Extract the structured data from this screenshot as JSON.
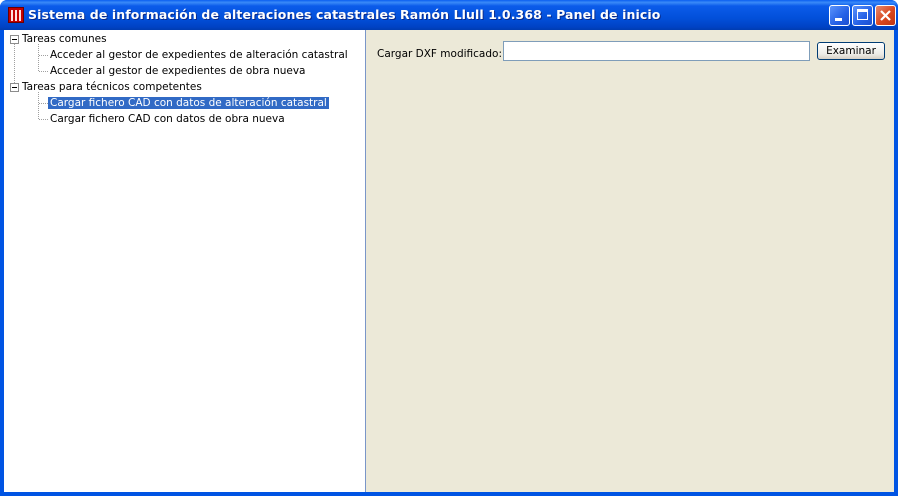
{
  "window": {
    "title": "Sistema de información de alteraciones catastrales Ramón Llull 1.0.368 - Panel de inicio",
    "app_icon": "app-logo-icon",
    "controls": [
      "minimize-icon",
      "maximize-icon",
      "close-icon"
    ]
  },
  "tree": {
    "groups": [
      {
        "label": "Tareas comunes",
        "expanded": true,
        "items": [
          {
            "label": "Acceder al gestor de expedientes de alteración catastral",
            "selected": false
          },
          {
            "label": "Acceder al gestor de expedientes de obra nueva",
            "selected": false
          }
        ]
      },
      {
        "label": "Tareas para técnicos competentes",
        "expanded": true,
        "items": [
          {
            "label": "Cargar fichero CAD con datos de alteración catastral",
            "selected": true
          },
          {
            "label": "Cargar fichero CAD con datos de obra nueva",
            "selected": false
          }
        ]
      }
    ]
  },
  "panel": {
    "dxf_label": "Cargar DXF modificado:",
    "dxf_value": "",
    "browse_label": "Examinar"
  },
  "colors": {
    "titlebar": "#0054e3",
    "selection": "#316ac5",
    "panel_bg": "#ece9d8"
  }
}
